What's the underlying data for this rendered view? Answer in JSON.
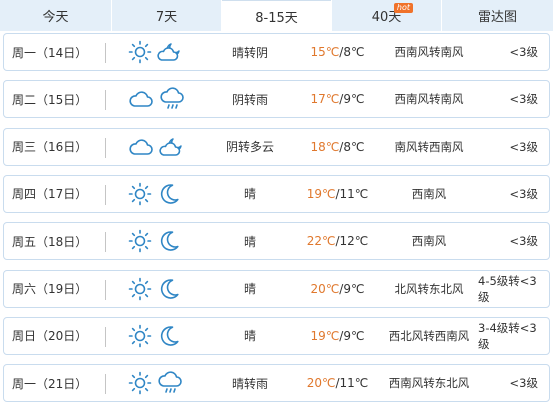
{
  "tabs": [
    {
      "label": "今天",
      "active": false
    },
    {
      "label": "7天",
      "active": false
    },
    {
      "label": "8-15天",
      "active": true
    },
    {
      "label": "40天",
      "active": false,
      "badge": "hot"
    },
    {
      "label": "雷达图",
      "active": false
    }
  ],
  "days": [
    {
      "date": "周一（14日）",
      "icons": [
        "sun-icon",
        "cloudy-night-icon"
      ],
      "desc": "晴转阴",
      "hi": "15℃",
      "lo": "/8℃",
      "wind": "西南风转南风",
      "level": "<3级"
    },
    {
      "date": "周二（15日）",
      "icons": [
        "cloud-icon",
        "rain-icon"
      ],
      "desc": "阴转雨",
      "hi": "17℃",
      "lo": "/9℃",
      "wind": "西南风转南风",
      "level": "<3级"
    },
    {
      "date": "周三（16日）",
      "icons": [
        "cloud-icon",
        "cloudy-night-icon"
      ],
      "desc": "阴转多云",
      "hi": "18℃",
      "lo": "/8℃",
      "wind": "南风转西南风",
      "level": "<3级"
    },
    {
      "date": "周四（17日）",
      "icons": [
        "sun-icon",
        "moon-icon"
      ],
      "desc": "晴",
      "hi": "19℃",
      "lo": "/11℃",
      "wind": "西南风",
      "level": "<3级"
    },
    {
      "date": "周五（18日）",
      "icons": [
        "sun-icon",
        "moon-icon"
      ],
      "desc": "晴",
      "hi": "22℃",
      "lo": "/12℃",
      "wind": "西南风",
      "level": "<3级"
    },
    {
      "date": "周六（19日）",
      "icons": [
        "sun-icon",
        "moon-icon"
      ],
      "desc": "晴",
      "hi": "20℃",
      "lo": "/9℃",
      "wind": "北风转东北风",
      "level": "4-5级转<3级"
    },
    {
      "date": "周日（20日）",
      "icons": [
        "sun-icon",
        "moon-icon"
      ],
      "desc": "晴",
      "hi": "19℃",
      "lo": "/9℃",
      "wind": "西北风转西南风",
      "level": "3-4级转<3级"
    },
    {
      "date": "周一（21日）",
      "icons": [
        "sun-icon",
        "rain-icon"
      ],
      "desc": "晴转雨",
      "hi": "20℃",
      "lo": "/11℃",
      "wind": "西南风转东北风",
      "level": "<3级"
    }
  ],
  "colors": {
    "accent": "#e0782d",
    "tab_bg": "#e4eff9",
    "border": "#c9dcee",
    "icon": "#2f86c5"
  }
}
